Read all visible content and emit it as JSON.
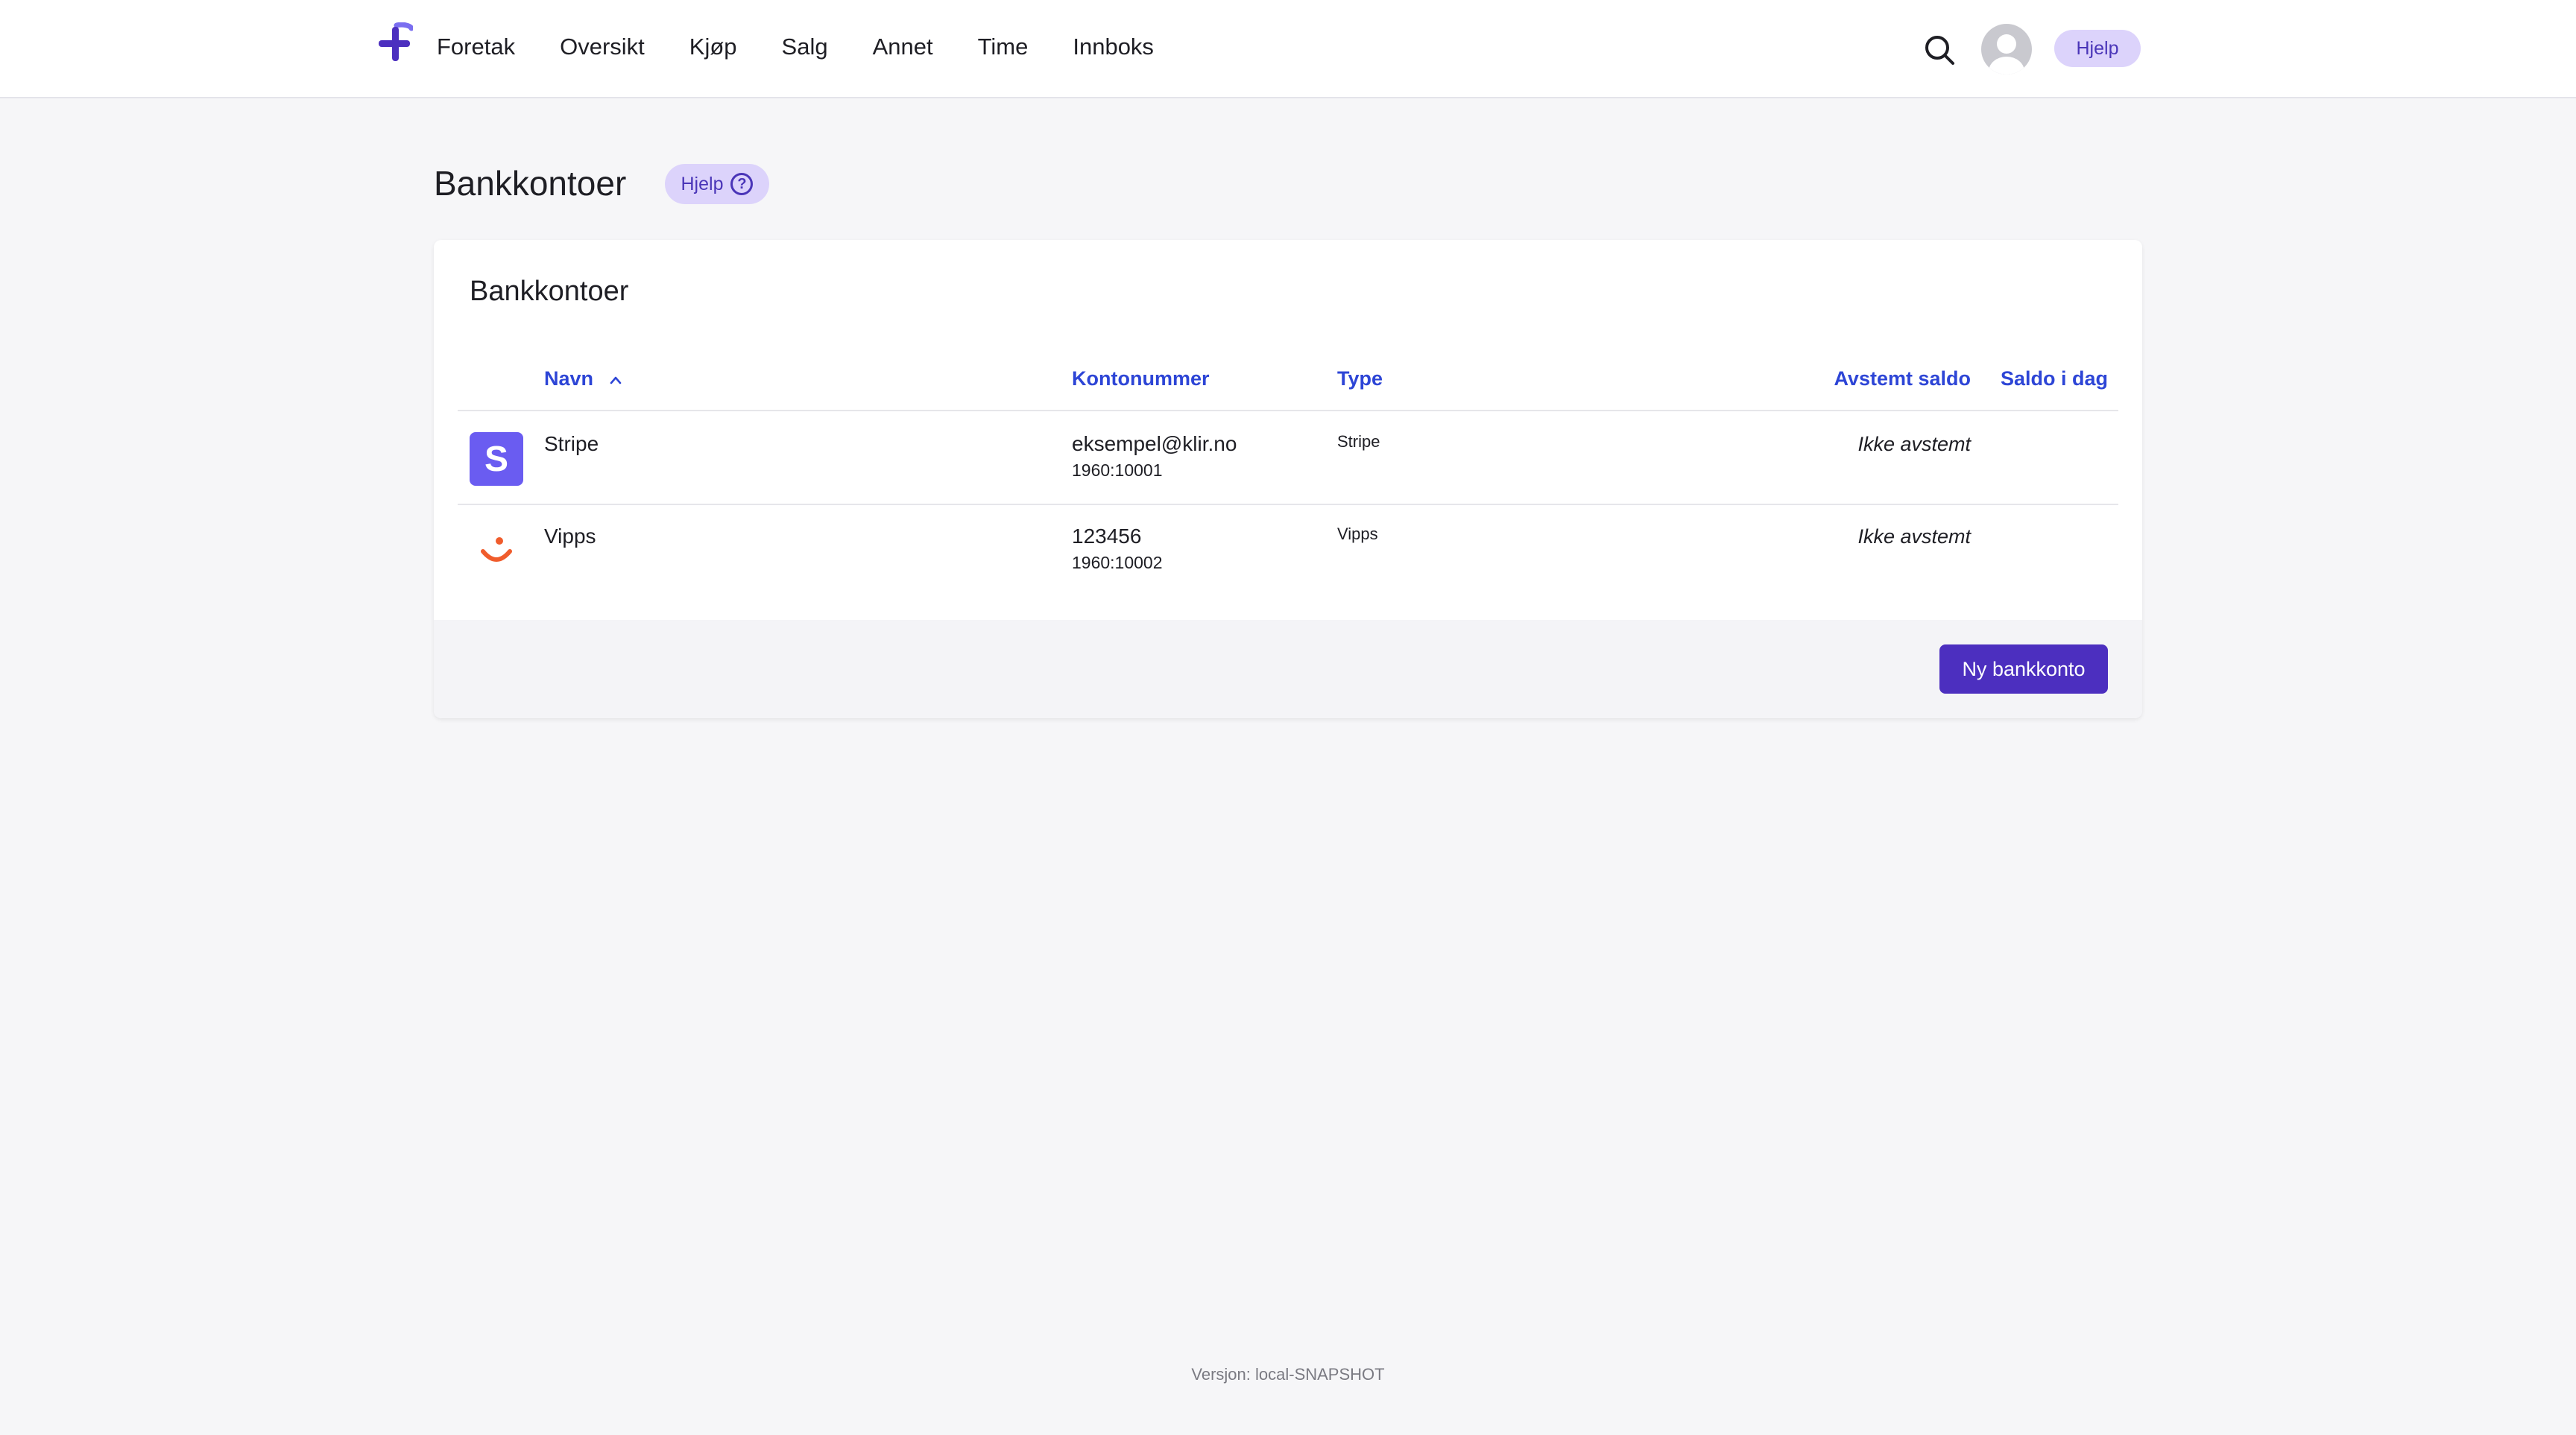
{
  "nav": {
    "items": [
      "Foretak",
      "Oversikt",
      "Kjøp",
      "Salg",
      "Annet",
      "Time",
      "Innboks"
    ],
    "help_label": "Hjelp",
    "logo_icon": "plus-logo-icon",
    "search_icon": "search-icon",
    "avatar_icon": "user-avatar-icon"
  },
  "page": {
    "title": "Bankkontoer",
    "help_label": "Hjelp"
  },
  "card": {
    "title": "Bankkontoer",
    "columns": {
      "name": "Navn",
      "account": "Kontonummer",
      "type": "Type",
      "reconciled": "Avstemt saldo",
      "today": "Saldo i dag"
    },
    "sort": {
      "column": "name",
      "direction": "ascending"
    },
    "rows": [
      {
        "logo_icon": "stripe-logo-icon",
        "logo_letter": "S",
        "name": "Stripe",
        "account": "eksempel@klir.no",
        "ledger": "1960:10001",
        "type": "Stripe",
        "reconciled": "Ikke avstemt",
        "today": ""
      },
      {
        "logo_icon": "vipps-logo-icon",
        "name": "Vipps",
        "account": "123456",
        "ledger": "1960:10002",
        "type": "Vipps",
        "reconciled": "Ikke avstemt",
        "today": ""
      }
    ],
    "new_button_label": "Ny bankkonto"
  },
  "footer": {
    "version": "Versjon: local-SNAPSHOT"
  },
  "colors": {
    "accent": "#4c2fbf",
    "link": "#2d45d6",
    "pill_bg": "#dcd3fb",
    "highlight": "#e7311d",
    "stripe": "#6a5cf1",
    "vipps": "#f05c2c"
  }
}
